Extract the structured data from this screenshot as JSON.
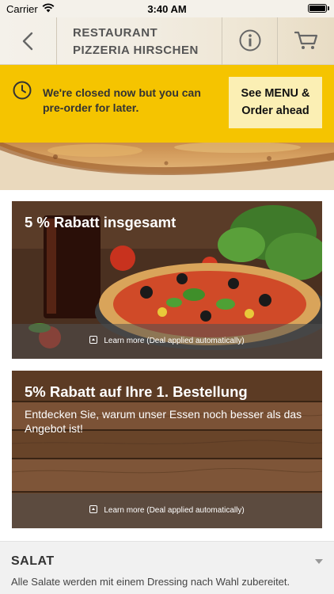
{
  "status_bar": {
    "carrier": "Carrier",
    "time": "3:40 AM"
  },
  "header": {
    "title_line1": "RESTAURANT",
    "title_line2": "PIZZERIA HIRSCHEN",
    "icons": [
      "chevron-left-icon",
      "info-icon",
      "cart-icon"
    ]
  },
  "closed_banner": {
    "message": "We're closed now but you can pre-order for later.",
    "button_line1": "See MENU &",
    "button_line2": "Order ahead",
    "accent_color": "#f5c400"
  },
  "deals": [
    {
      "title": "5 % Rabatt insgesamt",
      "subtitle": "",
      "learn_more": "Learn more (Deal applied automatically)"
    },
    {
      "title": "5% Rabatt auf Ihre 1. Bestellung",
      "subtitle": "Entdecken Sie, warum unser Essen noch besser als das Angebot ist!",
      "learn_more": "Learn more (Deal applied automatically)"
    }
  ],
  "category": {
    "title": "SALAT",
    "description": "Alle Salate werden mit einem Dressing nach Wahl zubereitet."
  }
}
